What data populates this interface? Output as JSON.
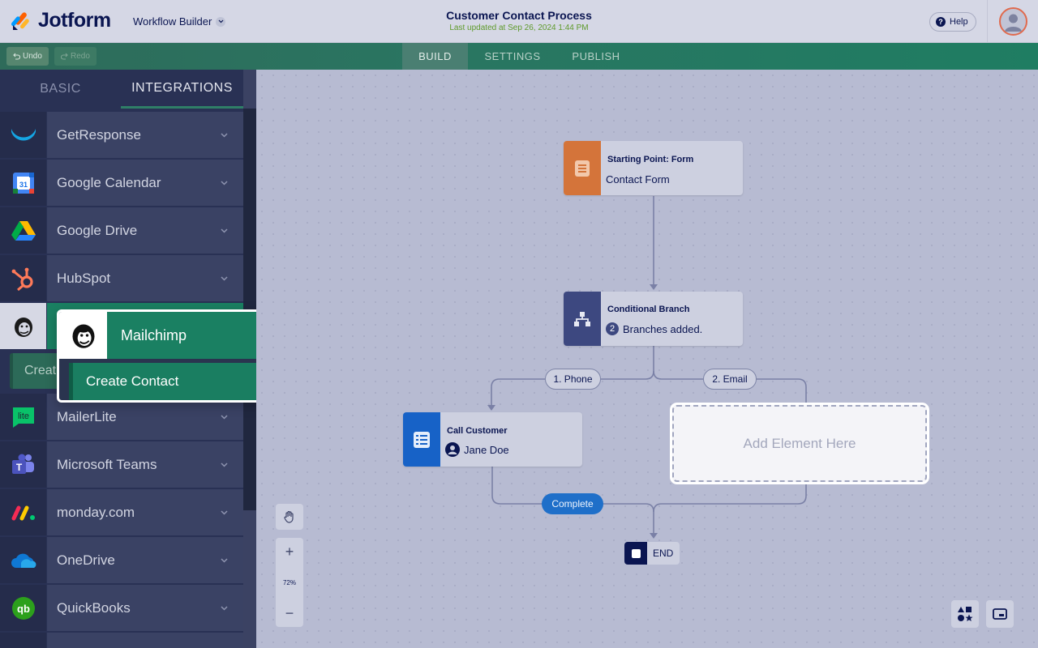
{
  "app": {
    "brand": "Jotform",
    "module": "Workflow Builder",
    "title": "Customer Contact Process",
    "updated": "Last updated at Sep 26, 2024 1:44 PM",
    "help_label": "Help"
  },
  "toolbar": {
    "undo_label": "Undo",
    "redo_label": "Redo",
    "tabs": [
      {
        "label": "BUILD",
        "active": true
      },
      {
        "label": "SETTINGS",
        "active": false
      },
      {
        "label": "PUBLISH",
        "active": false
      }
    ]
  },
  "sidebar": {
    "tabs": [
      {
        "label": "BASIC",
        "active": false
      },
      {
        "label": "INTEGRATIONS",
        "active": true
      }
    ],
    "items": [
      {
        "label": "GetResponse",
        "icon": "getresponse-icon"
      },
      {
        "label": "Google Calendar",
        "icon": "google-calendar-icon"
      },
      {
        "label": "Google Drive",
        "icon": "google-drive-icon"
      },
      {
        "label": "HubSpot",
        "icon": "hubspot-icon"
      },
      {
        "label": "MailerLite",
        "icon": "mailerlite-icon"
      },
      {
        "label": "Microsoft Teams",
        "icon": "microsoft-teams-icon"
      },
      {
        "label": "monday.com",
        "icon": "monday-icon"
      },
      {
        "label": "OneDrive",
        "icon": "onedrive-icon"
      },
      {
        "label": "QuickBooks",
        "icon": "quickbooks-icon"
      }
    ],
    "create_stub": "Creat"
  },
  "popup": {
    "title": "Mailchimp",
    "action": "Create Contact"
  },
  "canvas": {
    "start_node": {
      "title": "Starting Point: Form",
      "text": "Contact Form"
    },
    "branch_node": {
      "title": "Conditional Branch",
      "count": "2",
      "text": "Branches added."
    },
    "branches": [
      "1. Phone",
      "2. Email"
    ],
    "call_node": {
      "title": "Call Customer",
      "assignee": "Jane Doe"
    },
    "add_element": "Add Element Here",
    "complete_label": "Complete",
    "end_label": "END",
    "zoom": "72%"
  },
  "colors": {
    "accent_green": "#1a8062",
    "start_orange": "#d4743a",
    "branch_navy": "#3d4880",
    "call_blue": "#1762c7",
    "complete_blue": "#1f6fc9"
  }
}
